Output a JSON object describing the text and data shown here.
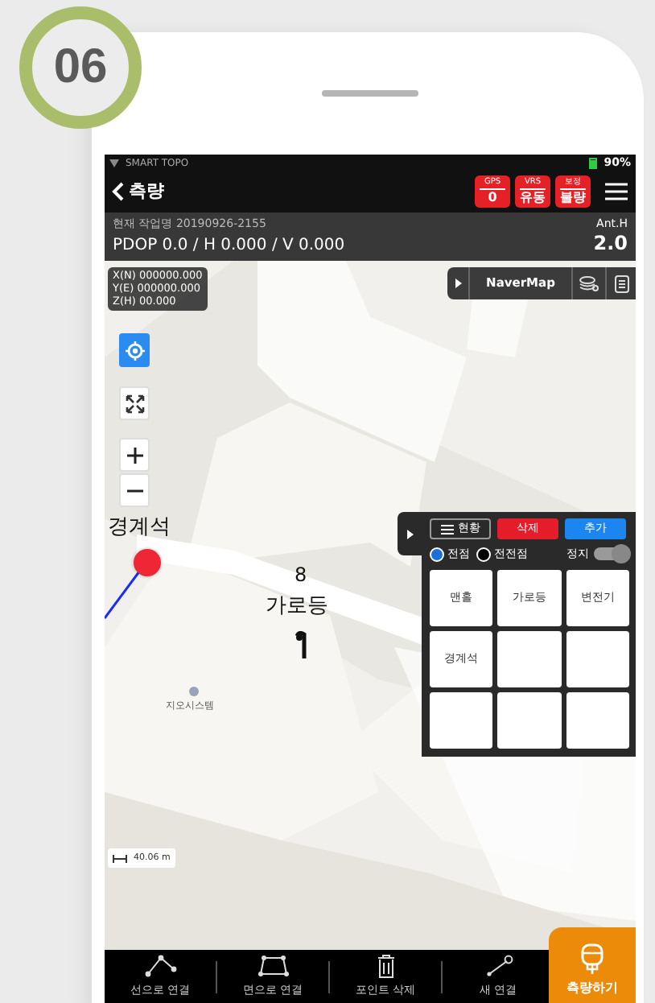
{
  "step_badge": "06",
  "status_bar": {
    "app_name": "SMART TOPO",
    "battery": "90%"
  },
  "app_bar": {
    "title": "측량",
    "badges": [
      {
        "label": "GPS",
        "value": "0"
      },
      {
        "label": "VRS",
        "value": "유동"
      },
      {
        "label": "보정",
        "value": "불량"
      }
    ]
  },
  "info_bar": {
    "job": "현재 작업명 20190926-2155",
    "precision": "PDOP 0.0 / H 0.000 / V 0.000",
    "ant_label": "Ant.H",
    "ant_value": "2.0"
  },
  "map": {
    "coordinates": [
      "X(N) 000000.000",
      "Y(E) 000000.000",
      "Z(H) 00.000"
    ],
    "layer": "NaverMap",
    "poi_label": "지오시스템",
    "markers": [
      {
        "kind": "point",
        "label": "경계석",
        "color": "#ee2636"
      },
      {
        "kind": "lamp",
        "number": "8",
        "label": "가로등"
      }
    ],
    "scale": "40.06 m"
  },
  "panel": {
    "list_button": "현황",
    "delete_button": "삭제",
    "add_button": "추가",
    "radios": [
      {
        "label": "전점",
        "selected": true
      },
      {
        "label": "전전점",
        "selected": false
      }
    ],
    "toggle": {
      "label": "정지",
      "on": true
    },
    "cells": [
      "맨홀",
      "가로등",
      "변전기",
      "경계석"
    ]
  },
  "toolbar": {
    "items": [
      {
        "kind": "line",
        "label": "선으로 연결"
      },
      {
        "kind": "polygon",
        "label": "면으로 연결"
      },
      {
        "kind": "trash",
        "label": "포인트 삭제"
      },
      {
        "kind": "link",
        "label": "새 연결"
      }
    ],
    "measure_button": "측량하기"
  }
}
